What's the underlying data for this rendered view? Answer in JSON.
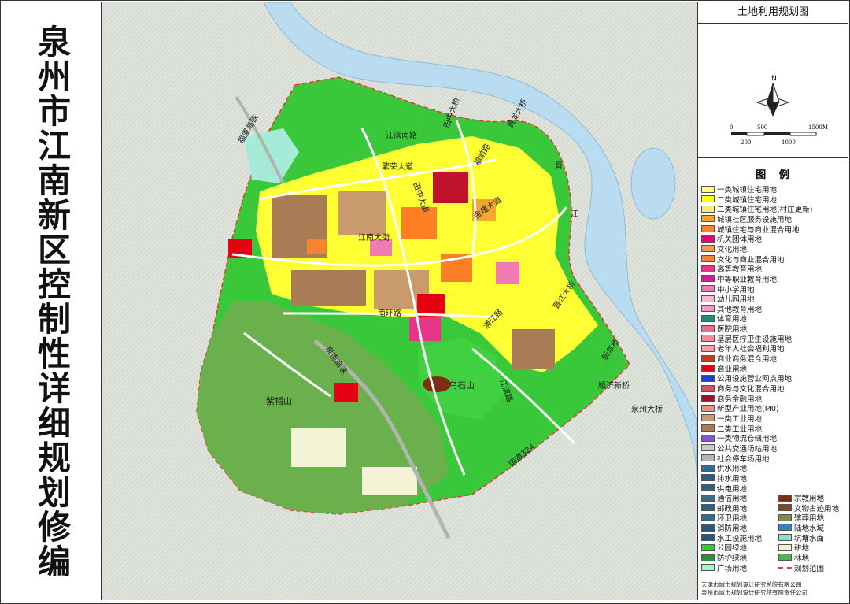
{
  "title": "泉州市江南新区控制性详细规划修编",
  "map_title": "土地利用规划图",
  "scale_bar": {
    "top_labels": [
      "0",
      "500",
      "1500M"
    ],
    "bottom_labels": [
      "200",
      "1000"
    ]
  },
  "compass_label": "N",
  "legend_title": "图 例",
  "legend_left": [
    {
      "label": "一类城镇住宅用地",
      "color": "#ffff7a"
    },
    {
      "label": "二类城镇住宅用地",
      "color": "#ffff00"
    },
    {
      "label": "二类城镇住宅用地(村庄更新)",
      "color": "#ffe97a"
    },
    {
      "label": "城镇社区服务设施用地",
      "color": "#f4a62a"
    },
    {
      "label": "城镇住宅与商业混合用地",
      "color": "#ff7f27"
    },
    {
      "label": "机关团体用地",
      "color": "#e6007e"
    },
    {
      "label": "文化用地",
      "color": "#f39a4a"
    },
    {
      "label": "文化与商业混合用地",
      "color": "#f4842f"
    },
    {
      "label": "高等教育用地",
      "color": "#e8348b"
    },
    {
      "label": "中等职业教育用地",
      "color": "#d61aa0"
    },
    {
      "label": "中小学用地",
      "color": "#f07ab2"
    },
    {
      "label": "幼儿园用地",
      "color": "#f7b7d2"
    },
    {
      "label": "其他教育用地",
      "color": "#f29bc2"
    },
    {
      "label": "体育用地",
      "color": "#1e8c78"
    },
    {
      "label": "医院用地",
      "color": "#ee6a8a"
    },
    {
      "label": "基层医疗卫生设施用地",
      "color": "#f38ba0"
    },
    {
      "label": "老年人社会福利用地",
      "color": "#f5a3a3"
    },
    {
      "label": "商业商务混合用地",
      "color": "#c83c1e"
    },
    {
      "label": "商业用地",
      "color": "#e60012"
    },
    {
      "label": "公用设施营业网点用地",
      "color": "#1f3fd1"
    },
    {
      "label": "商务与文化混合用地",
      "color": "#d94f63"
    },
    {
      "label": "商务金融用地",
      "color": "#a1122a"
    },
    {
      "label": "新型产业用地(M0)",
      "color": "#e3947c"
    },
    {
      "label": "一类工业用地",
      "color": "#c99a6b"
    },
    {
      "label": "二类工业用地",
      "color": "#a97c55"
    },
    {
      "label": "一类物流仓储用地",
      "color": "#8156c8"
    },
    {
      "label": "公共交通场站用地",
      "color": "#c9c9c9"
    },
    {
      "label": "社会停车场用地",
      "color": "#b4b4b4"
    },
    {
      "label": "供水用地",
      "color": "#2a6f9a"
    },
    {
      "label": "排水用地",
      "color": "#285e86"
    },
    {
      "label": "供电用地",
      "color": "#31617e"
    },
    {
      "label": "通信用地",
      "color": "#3a6c8c"
    },
    {
      "label": "邮政用地",
      "color": "#2f5f7f"
    },
    {
      "label": "环卫用地",
      "color": "#336b88"
    },
    {
      "label": "消防用地",
      "color": "#2c5878"
    },
    {
      "label": "水工设施用地",
      "color": "#245780"
    },
    {
      "label": "公园绿地",
      "color": "#33cc33"
    },
    {
      "label": "防护绿地",
      "color": "#2f8f3f"
    },
    {
      "label": "广场用地",
      "color": "#a6f0cc"
    }
  ],
  "legend_right": [
    {
      "label": "宗教用地",
      "color": "#7a2e12"
    },
    {
      "label": "文物古迹用地",
      "color": "#8b4513"
    },
    {
      "label": "殡葬用地",
      "color": "#7d8b4b"
    },
    {
      "label": "陆地水域",
      "color": "#2e86c1"
    },
    {
      "label": "坑塘水面",
      "color": "#7fe3d6"
    },
    {
      "label": "耕地",
      "color": "#f4f2d4"
    },
    {
      "label": "林地",
      "color": "#5cab5c"
    },
    {
      "label": "规划范围",
      "color": "#e53935",
      "dashed": true
    }
  ],
  "footer_lines": [
    "天津市城市规划设计研究总院有限公司",
    "泉州市城市规划设计研究院有限责任公司"
  ],
  "map_labels": {
    "fufu": "福厦高铁",
    "jiangbin": "江滨南路",
    "fanrong": "繁荣大道",
    "tianzhong_bridge": "田中大桥",
    "huanglong_bridge": "黄龙大桥",
    "tianzhong": "田中大道",
    "fuqian": "福前路",
    "jinjiang_av": "金瑾大道",
    "jiangnan": "江南大街",
    "nanhuan": "南环路",
    "pujiang": "浦江路",
    "quannan": "泉南高速",
    "zimaoshan": "紫帽山",
    "wushishan": "乌石山",
    "jinjiang_bridge": "晋江大桥",
    "xinhua_bridge": "新华桥",
    "shunji": "顺济新桥",
    "quanzhou_bridge": "泉州大桥",
    "guodao": "国道324",
    "jin": "晋",
    "jiang": "江",
    "xiangjiang": "江滨路"
  }
}
